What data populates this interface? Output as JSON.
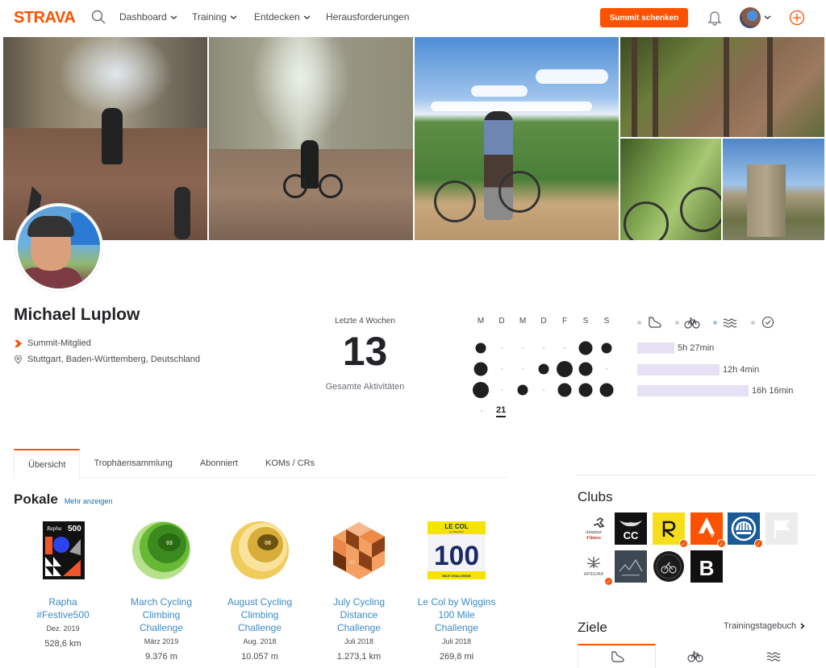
{
  "nav": {
    "logo": "STRAVA",
    "links": [
      {
        "label": "Dashboard",
        "has_dropdown": true
      },
      {
        "label": "Training",
        "has_dropdown": true
      },
      {
        "label": "Entdecken",
        "has_dropdown": true
      },
      {
        "label": "Herausforderungen",
        "has_dropdown": false
      }
    ],
    "cta_label": "Summit schenken",
    "icons": [
      "search-icon",
      "bell-icon",
      "avatar",
      "chevron-down-icon",
      "plus-circle-icon"
    ],
    "accent_color": "#fc5200"
  },
  "profile": {
    "name": "Michael Luplow",
    "membership": "Summit-Mitglied",
    "location": "Stuttgart, Baden-Württemberg, Deutschland"
  },
  "activity_summary": {
    "period_label": "Letzte 4 Wochen",
    "total": "13",
    "total_label": "Gesamte Aktivitäten",
    "weekdays": [
      "M",
      "D",
      "M",
      "D",
      "F",
      "S",
      "S"
    ],
    "weeks": [
      [
        2,
        0,
        0,
        0,
        0,
        3,
        2
      ],
      [
        3,
        0,
        0,
        2,
        4,
        3,
        0
      ],
      [
        4,
        0,
        2,
        0,
        3,
        3,
        3
      ],
      [
        0
      ]
    ],
    "current_week_label": "21"
  },
  "sport_stats": {
    "sports": [
      {
        "name": "run",
        "icon": "shoe-icon",
        "active": false
      },
      {
        "name": "ride",
        "icon": "bike-icon",
        "active": false
      },
      {
        "name": "swim",
        "icon": "swim-icon",
        "active": true
      },
      {
        "name": "other",
        "icon": "clock-icon",
        "active": false
      }
    ],
    "bars": [
      {
        "label": "5h 27min",
        "fraction": 0.335
      },
      {
        "label": "12h 4min",
        "fraction": 0.742
      },
      {
        "label": "16h 16min",
        "fraction": 1.0
      }
    ],
    "bar_color": "#e6e1f4"
  },
  "tabs": [
    {
      "label": "Übersicht",
      "active": true
    },
    {
      "label": "Trophäensammlung",
      "active": false
    },
    {
      "label": "Abonniert",
      "active": false
    },
    {
      "label": "KOMs / CRs",
      "active": false
    }
  ],
  "trophies": {
    "title": "Pokale",
    "more_label": "Mehr anzeigen",
    "items": [
      {
        "name_lines": [
          "Rapha",
          "#Festive500"
        ],
        "date": "Dez. 2019",
        "value": "528,6 km",
        "badge": "rapha-festive500-badge"
      },
      {
        "name_lines": [
          "March Cycling",
          "Climbing",
          "Challenge"
        ],
        "date": "März 2019",
        "value": "9.376 m",
        "badge": "march-climbing-badge",
        "badge_text": "03"
      },
      {
        "name_lines": [
          "August Cycling",
          "Climbing",
          "Challenge"
        ],
        "date": "Aug. 2018",
        "value": "10.057 m",
        "badge": "august-climbing-badge",
        "badge_text": "08"
      },
      {
        "name_lines": [
          "July Cycling",
          "Distance",
          "Challenge"
        ],
        "date": "Juli 2018",
        "value": "1.273,1 km",
        "badge": "july-distance-badge",
        "badge_text": "07"
      },
      {
        "name_lines": [
          "Le Col by Wiggins",
          "100 Mile",
          "Challenge"
        ],
        "date": "Juli 2018",
        "value": "269,8 mi",
        "badge": "lecol-100-badge",
        "badge_text": "100",
        "badge_top": "LE COL",
        "badge_sub": "by WIGGINS",
        "badge_bottom": "MILE CHALLENGE"
      }
    ]
  },
  "clubs": {
    "title": "Clubs",
    "items": [
      {
        "name": "amateur-fitness-club",
        "text": "Amateur Fitness",
        "verified": false
      },
      {
        "name": "cc-club",
        "text": "CC",
        "verified": false
      },
      {
        "name": "r-club",
        "text": "R",
        "verified": true
      },
      {
        "name": "strava-club",
        "text": "",
        "verified": true
      },
      {
        "name": "helmet-club",
        "text": "",
        "verified": true
      },
      {
        "name": "flag-club",
        "text": "",
        "verified": false
      },
      {
        "name": "apidura-club",
        "text": "APIDURA",
        "verified": true
      },
      {
        "name": "mountain-club",
        "text": "",
        "verified": false
      },
      {
        "name": "cycling-circle-club",
        "text": "",
        "verified": false
      },
      {
        "name": "b-club",
        "text": "B",
        "verified": false
      }
    ]
  },
  "goals": {
    "title": "Ziele",
    "link_label": "Trainingstagebuch",
    "tabs": [
      {
        "icon": "shoe-icon",
        "active": true
      },
      {
        "icon": "bike-icon",
        "active": false
      },
      {
        "icon": "swim-icon",
        "active": false
      }
    ]
  }
}
